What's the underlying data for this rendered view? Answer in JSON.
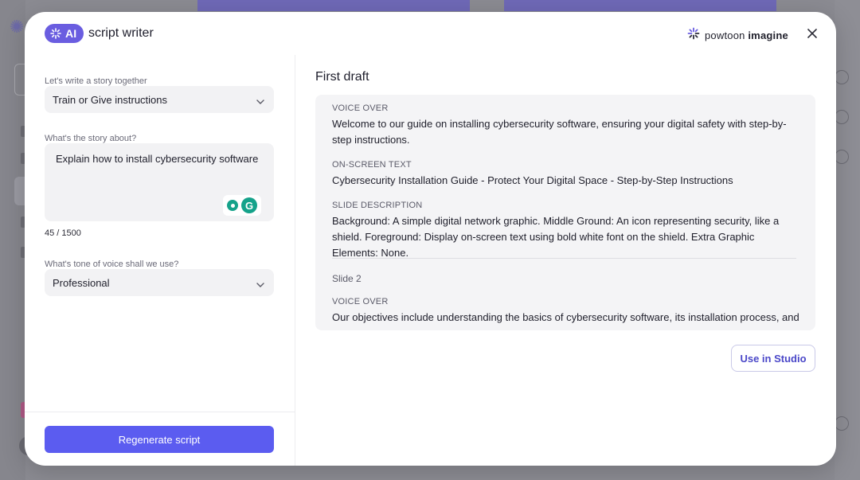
{
  "header": {
    "ai_badge": "AI",
    "title": "script writer",
    "brand_prefix": "powtoon",
    "brand_suffix": "imagine"
  },
  "form": {
    "story_label": "Let's write a story together",
    "story_type_value": "Train or Give instructions",
    "about_label": "What's the story about?",
    "about_value": "Explain how to install cybersecurity software",
    "char_count": "45 / 1500",
    "tone_label": "What's tone of voice shall we use?",
    "tone_value": "Professional",
    "regenerate_label": "Regenerate script"
  },
  "draft": {
    "title": "First draft",
    "vo_label_1": "VOICE OVER",
    "vo_text_1": "Welcome to our guide on installing cybersecurity software, ensuring your digital safety with step-by-step instructions.",
    "ost_label": "ON-SCREEN TEXT",
    "ost_text": "Cybersecurity Installation Guide - Protect Your Digital Space - Step-by-Step Instructions",
    "sd_label": "SLIDE DESCRIPTION",
    "sd_text": "Background: A simple digital network graphic. Middle Ground: An icon representing security, like a shield. Foreground: Display on-screen text using bold white font on the shield. Extra Graphic Elements: None.",
    "slide2_label": "Slide 2",
    "vo_label_2": "VOICE OVER",
    "vo_text_2": "Our objectives include understanding the basics of cybersecurity software, its installation process, and",
    "use_label": "Use in Studio"
  },
  "colors": {
    "accent": "#5b5cf0",
    "badge": "#6a5de0",
    "grammarly": "#15a28a"
  },
  "icons": [
    "sparkle-icon",
    "powtoon-logo-icon",
    "close-icon",
    "chevron-down-icon",
    "grammarly-icon",
    "bulb-icon"
  ]
}
